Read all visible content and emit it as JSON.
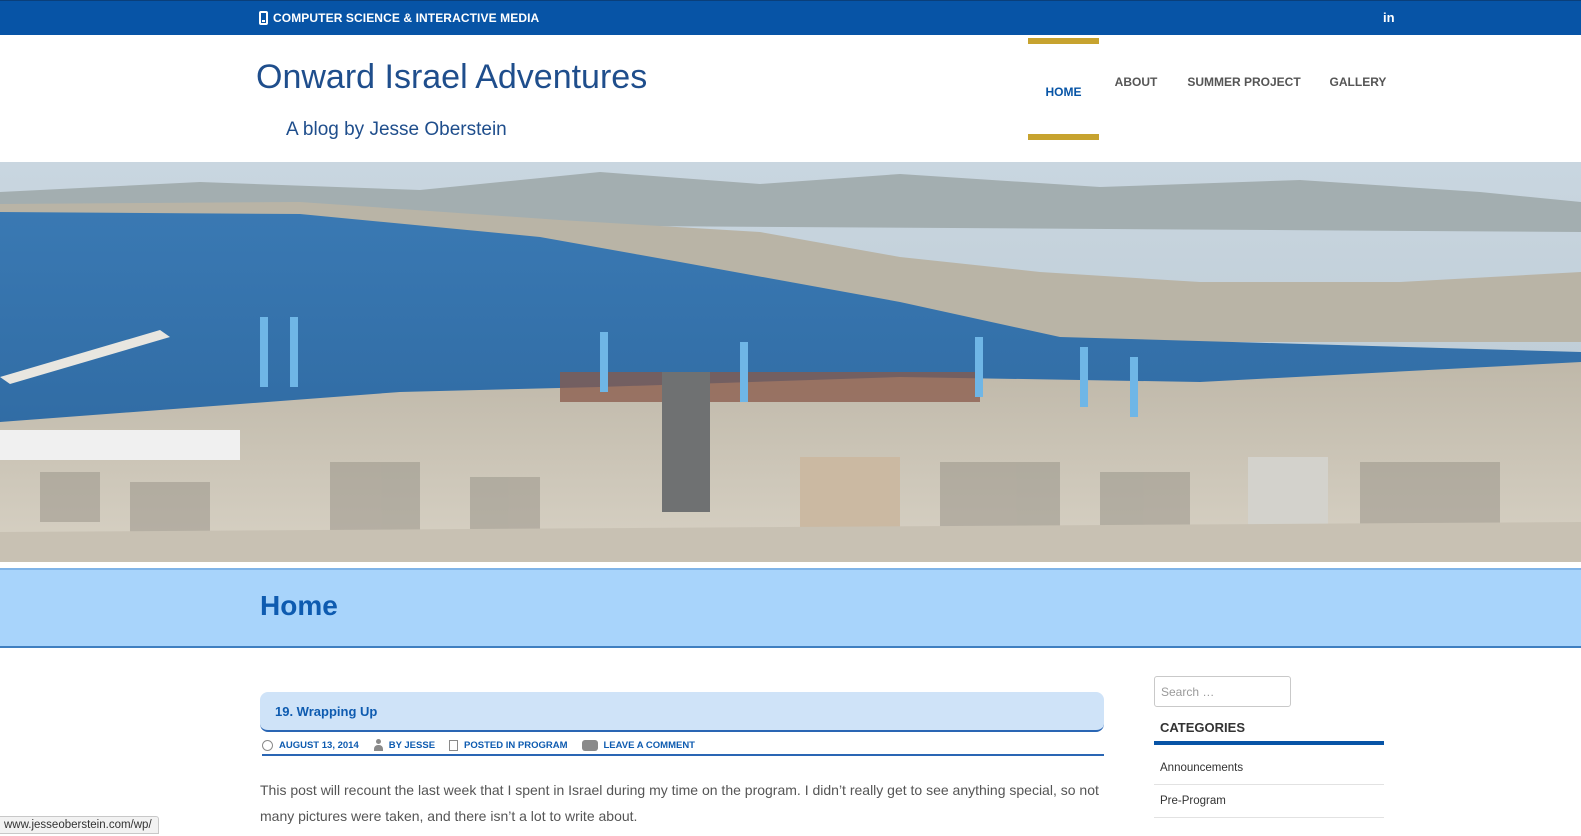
{
  "topbar": {
    "tagline": "COMPUTER SCIENCE & INTERACTIVE MEDIA",
    "social_icon": "linkedin-icon",
    "social_label": "in"
  },
  "header": {
    "title": "Onward Israel Adventures",
    "description": "A blog by Jesse Oberstein"
  },
  "nav": {
    "items": [
      {
        "label": "HOME",
        "active": true
      },
      {
        "label": "ABOUT",
        "active": false
      },
      {
        "label": "SUMMER PROJECT",
        "active": false
      },
      {
        "label": "GALLERY",
        "active": false
      }
    ]
  },
  "hero": {
    "description": "Panoramic view of Haifa port and bay"
  },
  "page": {
    "title": "Home"
  },
  "post": {
    "title": "19. Wrapping Up",
    "date": "AUGUST 13, 2014",
    "author": "BY JESSE",
    "posted_in_prefix": "POSTED IN",
    "category": "PROGRAM",
    "comment_link": "LEAVE A COMMENT",
    "excerpt": "This post will recount the last week that I spent in Israel during my time on the program.  I didn’t really get to see anything special, so not many pictures were taken, and there isn’t a lot to write about."
  },
  "sidebar": {
    "search_placeholder": "Search …",
    "categories_heading": "CATEGORIES",
    "categories": [
      "Announcements",
      "Pre-Program"
    ]
  },
  "status_bar": {
    "url": "www.jesseoberstein.com/wp/"
  },
  "colors": {
    "primary": "#0754a6",
    "accent": "#c7a32f",
    "band": "#a8d4fb"
  }
}
